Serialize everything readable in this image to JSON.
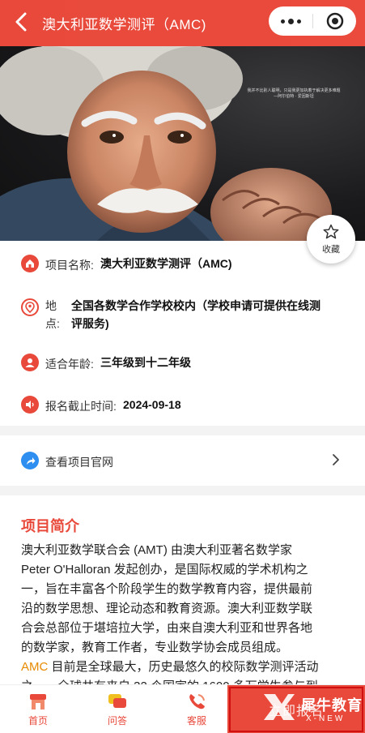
{
  "header": {
    "title": "澳大利亚数学测评（AMC)"
  },
  "hero": {
    "quote_line1": "我并不比别人聪明，只是我更加执着于解决更多难题",
    "quote_line2": "—阿尔伯特 · 爱因斯坦"
  },
  "favorite": {
    "label": "收藏"
  },
  "info": {
    "name_label": "项目名称:",
    "name_value": "澳大利亚数学测评（AMC)",
    "address_label_1": "地",
    "address_label_2": "点:",
    "address_line1": "全国各数学合作学校校内（学校申请可提供在线测",
    "address_line2": "评服务)",
    "age_label": "适合年龄:",
    "age_value": "三年级到十二年级",
    "deadline_label": "报名截止时间:",
    "deadline_value": "2024-09-18"
  },
  "link": {
    "label": "查看项目官网"
  },
  "intro": {
    "title": "项目简介",
    "lines": [
      "澳大利亚数学联合会 (AMT) 由澳大利亚著名数学家",
      "Peter O'Halloran 发起创办，是国际权威的学术机构之",
      "一，旨在丰富各个阶段学生的数学教育内容，提供最前",
      "沿的数学思想、理论动态和教育资源。澳大利亚数学联",
      "合会总部位于堪培拉大学，由来自澳大利亚和世界各地",
      "的数学家，教育工作者，专业数学协会成员组成。"
    ],
    "amc_highlight": "AMC",
    "amc_line1": " 目前是全球最大，历史最悠久的校际数学测评活动",
    "amc_line2": "之一，全球共有来自 32 个国家的 1600 多万学生参与到"
  },
  "tabbar": {
    "home": "首页",
    "qa": "问答",
    "service": "客服",
    "signup": "立即报名"
  },
  "watermark": {
    "name": "犀牛教育",
    "sub": "X-NEW"
  },
  "colors": {
    "primary": "#e8493b",
    "link_icon": "#2f8ff0",
    "highlight": "#e68a00"
  }
}
